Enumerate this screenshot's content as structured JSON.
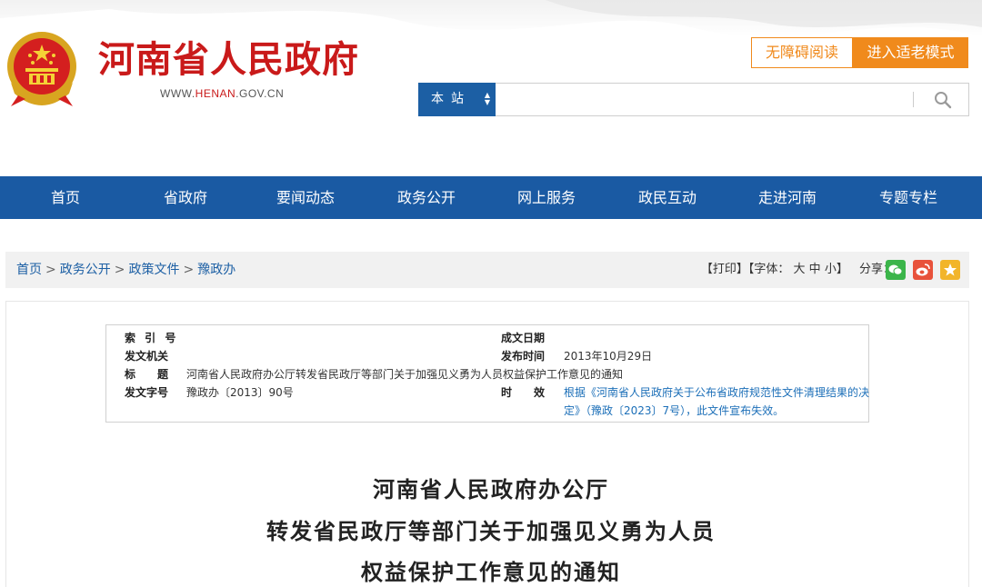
{
  "header": {
    "site_title": "河南省人民政府",
    "url_prefix": "WWW.",
    "url_highlight": "HENAN",
    "url_suffix": ".GOV.CN",
    "accessibility_label": "无障碍阅读",
    "elder_mode_label": "进入适老模式",
    "emblem_icon": "national-emblem-icon"
  },
  "search": {
    "scope_label": "本站",
    "placeholder": "",
    "search_icon": "search-icon"
  },
  "nav": {
    "items": [
      "首页",
      "省政府",
      "要闻动态",
      "政务公开",
      "网上服务",
      "政民互动",
      "走进河南",
      "专题专栏"
    ]
  },
  "breadcrumb": {
    "items": [
      "首页",
      "政务公开",
      "政策文件",
      "豫政办"
    ],
    "separator": ">"
  },
  "tools": {
    "print_label": "【打印】",
    "font_label": "【字体：",
    "font_large": "大",
    "font_medium": "中",
    "font_small": "小",
    "font_end": "】",
    "share_label": "分享："
  },
  "share_icons": {
    "wechat": "wechat-icon",
    "weibo": "weibo-icon",
    "favorite": "favorite-icon"
  },
  "colors": {
    "brand_red": "#c91a1a",
    "nav_blue": "#1a5aa3",
    "accent_orange": "#f08a1c",
    "link_blue": "#1c6fb8"
  },
  "meta": {
    "index_label": "索 引 号",
    "index_value": "",
    "issuer_label": "发文机关",
    "issuer_value": "",
    "title_label": "标　　题",
    "title_value": "河南省人民政府办公厅转发省民政厅等部门关于加强见义勇为人员权益保护工作意见的通知",
    "doc_no_label": "发文字号",
    "doc_no_value": "豫政办〔2013〕90号",
    "written_date_label": "成文日期",
    "written_date_value": "",
    "publish_date_label": "发布时间",
    "publish_date_value": "2013年10月29日",
    "validity_label": "时　　效",
    "validity_line1": "根据《河南省人民政府关于公布省政府规范性文件清理结果的决",
    "validity_line2": "定》（豫政〔2023〕7号），此文件宣布失效。"
  },
  "document": {
    "title_line1": "河南省人民政府办公厅",
    "title_line2": "转发省民政厅等部门关于加强见义勇为人员",
    "title_line3": "权益保护工作意见的通知"
  }
}
